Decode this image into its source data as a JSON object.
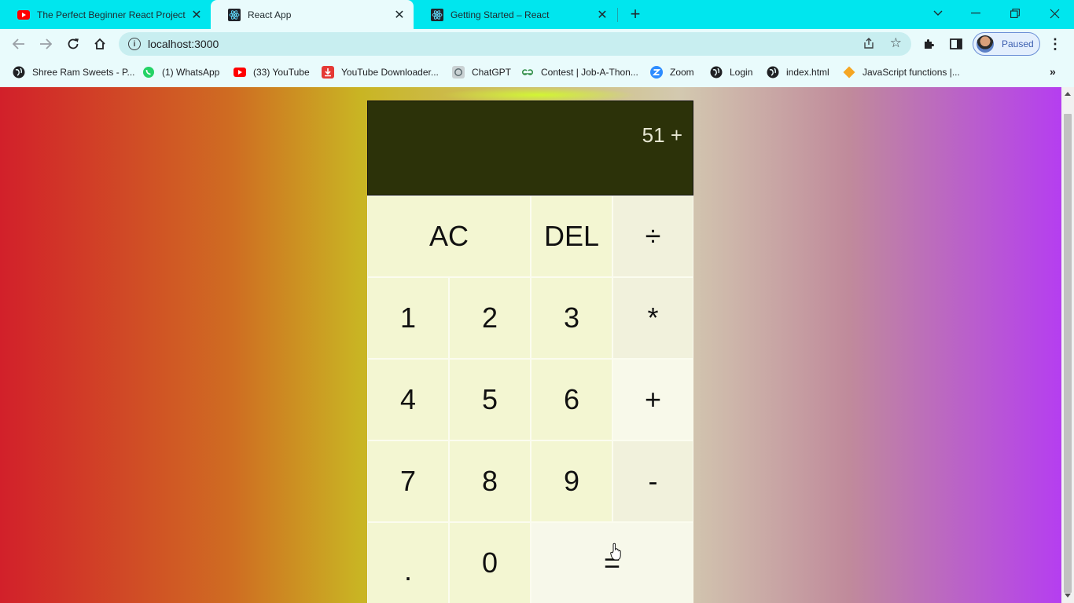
{
  "browser": {
    "tabs": [
      {
        "title": "The Perfect Beginner React Project",
        "favicon": "youtube-icon",
        "active": false
      },
      {
        "title": "React App",
        "favicon": "react-icon",
        "active": true
      },
      {
        "title": "Getting Started – React",
        "favicon": "react-icon",
        "active": false
      }
    ],
    "address": {
      "url": "localhost:3000"
    },
    "profile": {
      "status": "Paused"
    },
    "bookmarks": [
      {
        "label": "Shree Ram Sweets - P...",
        "icon": "globe-icon"
      },
      {
        "label": "(1) WhatsApp",
        "icon": "whatsapp-icon"
      },
      {
        "label": "(33) YouTube",
        "icon": "youtube-icon"
      },
      {
        "label": "YouTube Downloader...",
        "icon": "download-icon"
      },
      {
        "label": "ChatGPT",
        "icon": "chatgpt-icon"
      },
      {
        "label": "Contest | Job-A-Thon...",
        "icon": "gfg-icon"
      },
      {
        "label": "Zoom",
        "icon": "zoom-icon"
      },
      {
        "label": "Login",
        "icon": "globe-icon"
      },
      {
        "label": "index.html",
        "icon": "globe-icon"
      },
      {
        "label": "JavaScript functions |...",
        "icon": "diamond-icon"
      }
    ],
    "bookmarks_more": "»"
  },
  "calculator": {
    "display": "51 +",
    "keys": {
      "ac": "AC",
      "del": "DEL",
      "divide": "÷",
      "one": "1",
      "two": "2",
      "three": "3",
      "multiply": "*",
      "four": "4",
      "five": "5",
      "six": "6",
      "plus": "+",
      "seven": "7",
      "eight": "8",
      "nine": "9",
      "minus": "-",
      "dot": ".",
      "zero": "0",
      "equals": "="
    }
  },
  "colors": {
    "tab_strip": "#00e6ee",
    "toolbar": "#e9fbfc",
    "display_bg": "#2c3209",
    "key_bg": "#f3f6d2",
    "gradient_left": "#d2202a",
    "gradient_right": "#b53ef0"
  }
}
